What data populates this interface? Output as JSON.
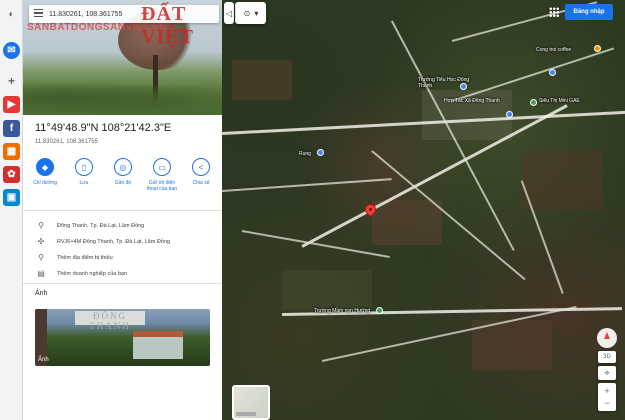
{
  "search": {
    "query": "11.830261, 108.361755"
  },
  "watermark": {
    "brand": "ĐẤT VIỆT",
    "site": "SANBATDONGSANVIET.VN"
  },
  "place": {
    "coords_dms": "11°49'48.9\"N 108°21'42.3\"E",
    "coords_decimal": "11.830261, 108.361755"
  },
  "actions": [
    {
      "label": "Chỉ đường",
      "icon": "directions-icon",
      "glyph": "◆",
      "primary": true
    },
    {
      "label": "Lưu",
      "icon": "bookmark-icon",
      "glyph": "▯",
      "primary": false
    },
    {
      "label": "Gần đó",
      "icon": "nearby-icon",
      "glyph": "◎",
      "primary": false
    },
    {
      "label": "Gửi tới điện thoại của bạn",
      "icon": "send-to-phone-icon",
      "glyph": "▭",
      "primary": false
    },
    {
      "label": "Chia sẻ",
      "icon": "share-icon",
      "glyph": "<",
      "primary": false
    }
  ],
  "info": {
    "address": "Đông Thanh, Tp. Đà Lạt, Lâm Đồng",
    "plus_code": "RVJ6+4M Đông Thanh, Tp. Đà Lạt, Lâm Đồng",
    "add_label": "Thêm địa điểm bị thiếu",
    "add_business": "Thêm doanh nghiệp của bạn"
  },
  "photos": {
    "section_label": "Ảnh",
    "tag": "Ảnh",
    "sign_text": "ĐÔNG THANH"
  },
  "map": {
    "labels": {
      "cafe": "Cong troi coffee",
      "school": "Trường Tiểu Học Đông Thanh",
      "coop": "Hợp Tác Xã Đông Thanh",
      "market": "Siêu Thị Mini GAE",
      "rung": "Rung",
      "school2": "Trường Mầm non Hướng"
    },
    "compass_label": "3D"
  },
  "topbar": {
    "chip1": "◁",
    "chip2": "⊙",
    "signin_label": "Đăng nhập"
  },
  "colors": {
    "accent": "#1a73e8",
    "pin": "#ea4335"
  }
}
